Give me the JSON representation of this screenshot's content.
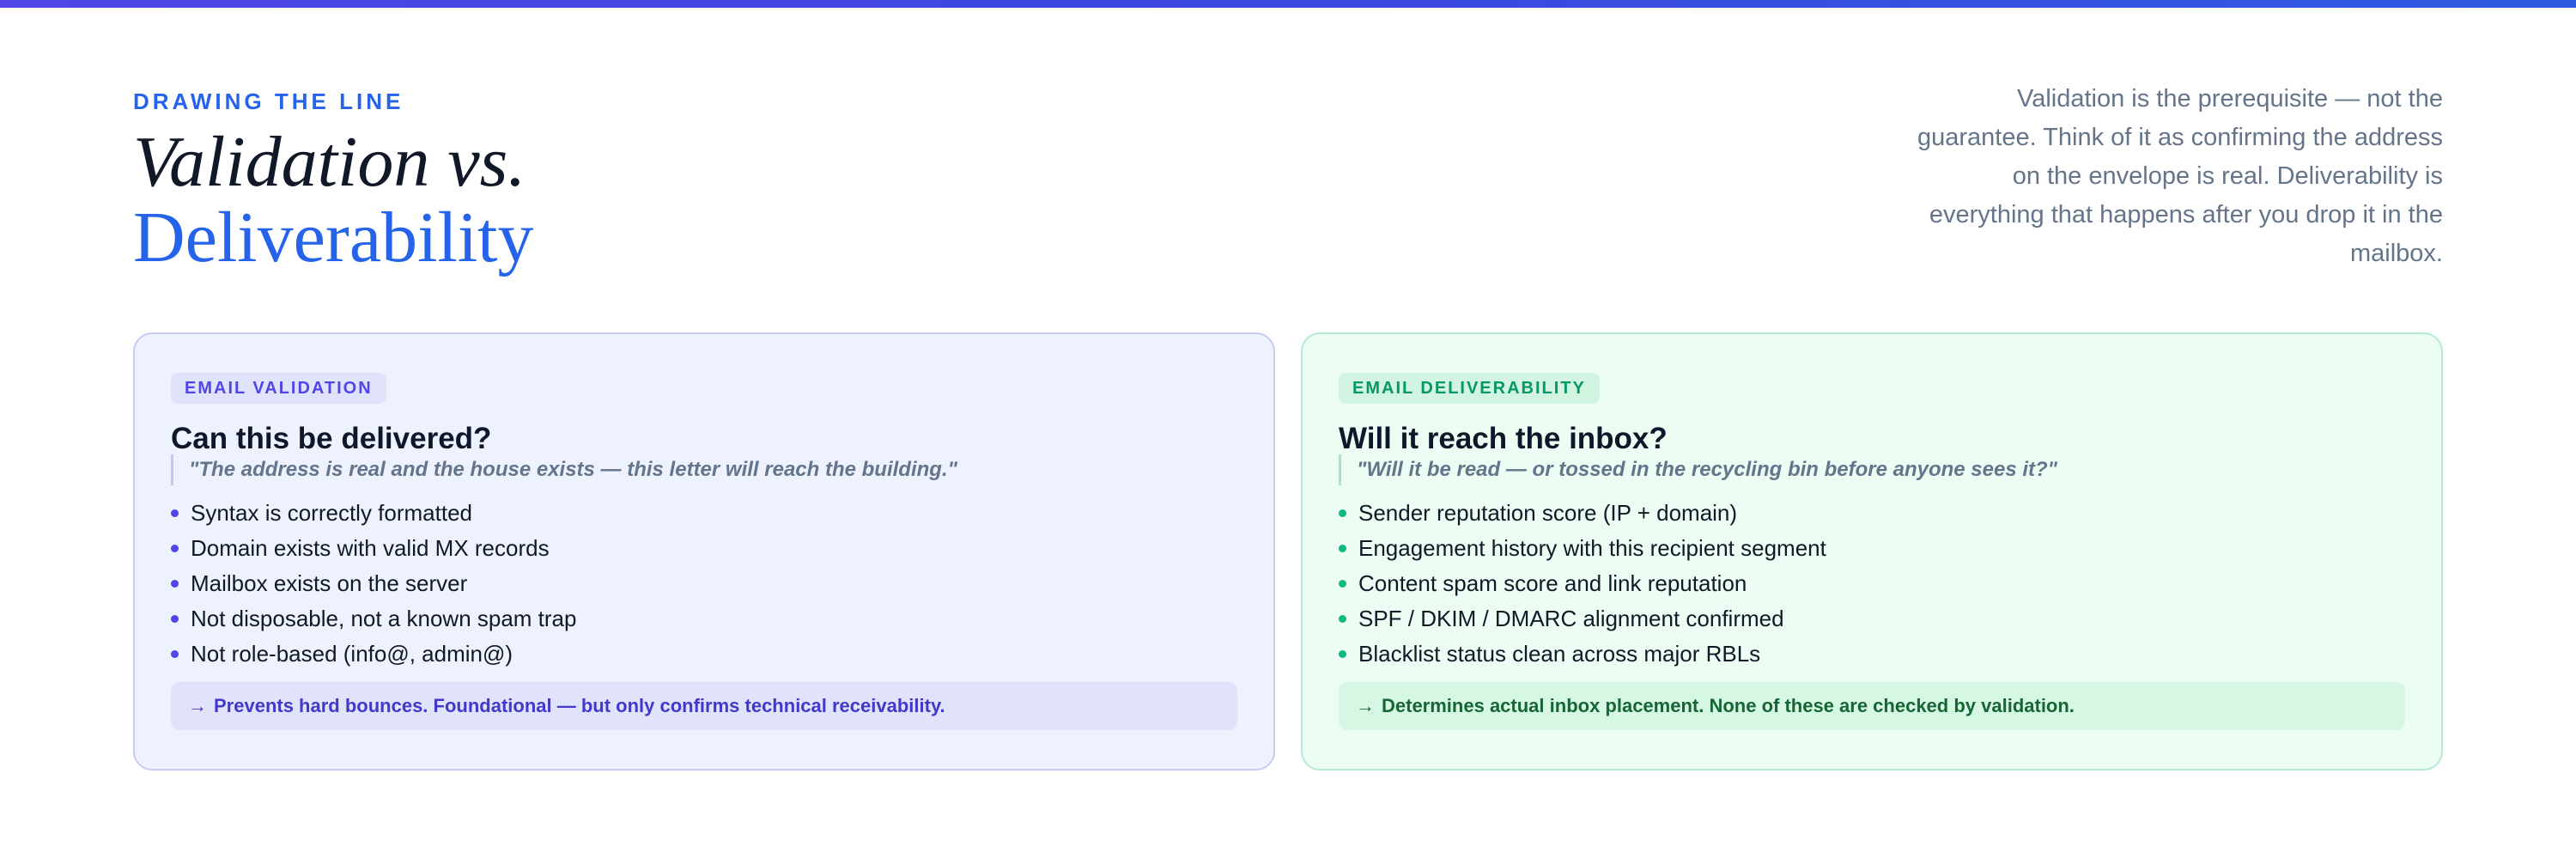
{
  "header": {
    "eyebrow": "DRAWING THE LINE",
    "title_line1": "Validation vs.",
    "title_line2": "Deliverability",
    "intro": "Validation is the prerequisite — not the guarantee. Think of it as confirming the address on the envelope is real. Deliverability is everything that happens after you drop it in the mailbox."
  },
  "cards": {
    "validation": {
      "badge": "EMAIL VALIDATION",
      "heading": "Can this be delivered?",
      "quote": "\"The address is real and the house exists — this letter will reach the building.\"",
      "items": [
        "Syntax is correctly formatted",
        "Domain exists with valid MX records",
        "Mailbox exists on the server",
        "Not disposable, not a known spam trap",
        "Not role-based (info@, admin@)"
      ],
      "note_arrow": "→",
      "note": "Prevents hard bounces. Foundational — but only confirms technical receivability.",
      "accent_color": "#4f46e5"
    },
    "deliverability": {
      "badge": "EMAIL DELIVERABILITY",
      "heading": "Will it reach the inbox?",
      "quote": "\"Will it be read — or tossed in the recycling bin before anyone sees it?\"",
      "items": [
        "Sender reputation score (IP + domain)",
        "Engagement history with this recipient segment",
        "Content spam score and link reputation",
        "SPF / DKIM / DMARC alignment confirmed",
        "Blacklist status clean across major RBLs"
      ],
      "note_arrow": "→",
      "note": "Determines actual inbox placement. None of these are checked by validation.",
      "accent_color": "#10b981"
    }
  }
}
